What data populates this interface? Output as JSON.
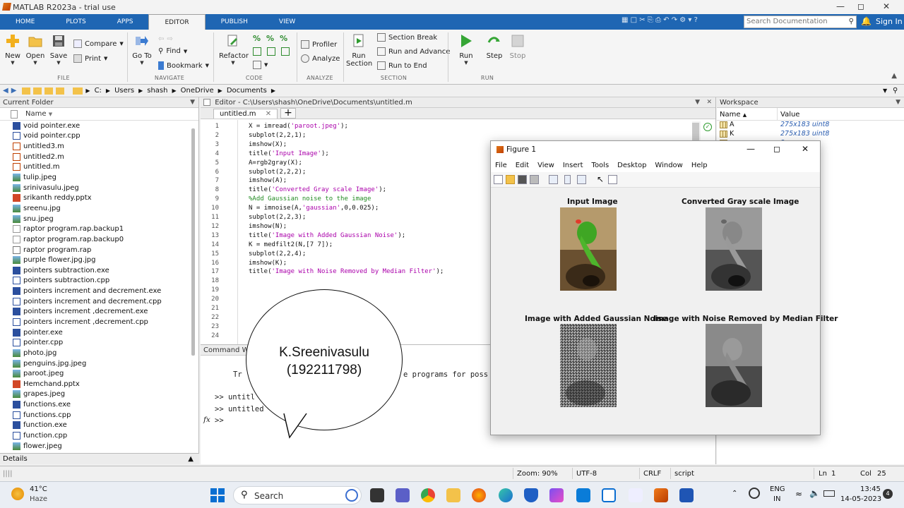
{
  "window": {
    "title": "MATLAB R2023a - trial use"
  },
  "tabs": [
    "HOME",
    "PLOTS",
    "APPS",
    "EDITOR",
    "PUBLISH",
    "VIEW"
  ],
  "search_doc": {
    "placeholder": "Search Documentation"
  },
  "sign_in": "Sign In",
  "ribbon": {
    "new": "New",
    "open": "Open",
    "save": "Save",
    "compare": "Compare",
    "print": "Print",
    "file_group": "FILE",
    "goto": "Go To",
    "find": "Find",
    "bookmark": "Bookmark",
    "navigate_group": "NAVIGATE",
    "refactor": "Refactor",
    "code_group": "CODE",
    "profiler": "Profiler",
    "analyze": "Analyze",
    "analyze_group": "ANALYZE",
    "run_section_1": "Run",
    "run_section_2": "Section",
    "section_break": "Section Break",
    "run_and_advance": "Run and Advance",
    "run_to_end": "Run to End",
    "section_group": "SECTION",
    "run": "Run",
    "step": "Step",
    "stop": "Stop",
    "run_group": "RUN"
  },
  "address": [
    "C:",
    "Users",
    "shash",
    "OneDrive",
    "Documents"
  ],
  "current_folder": {
    "title": "Current Folder",
    "col_name": "Name",
    "files": [
      {
        "name": "void pointer.exe",
        "type": "exe"
      },
      {
        "name": "void pointer.cpp",
        "type": "cpp"
      },
      {
        "name": "untitled3.m",
        "type": "m"
      },
      {
        "name": "untitled2.m",
        "type": "m"
      },
      {
        "name": "untitled.m",
        "type": "m"
      },
      {
        "name": "tulip.jpeg",
        "type": "img"
      },
      {
        "name": "srinivasulu.jpeg",
        "type": "img"
      },
      {
        "name": "srikanth reddy.pptx",
        "type": "ppt"
      },
      {
        "name": "sreenu.jpg",
        "type": "img"
      },
      {
        "name": "snu.jpeg",
        "type": "img"
      },
      {
        "name": "raptor program.rap.backup1",
        "type": "file"
      },
      {
        "name": "raptor program.rap.backup0",
        "type": "file"
      },
      {
        "name": "raptor program.rap",
        "type": "rap"
      },
      {
        "name": "purple flower.jpg.jpg",
        "type": "img"
      },
      {
        "name": "pointers subtraction.exe",
        "type": "exe"
      },
      {
        "name": "pointers subtraction.cpp",
        "type": "cpp"
      },
      {
        "name": "pointers increment and decrement.exe",
        "type": "exe"
      },
      {
        "name": "pointers increment and decrement.cpp",
        "type": "cpp"
      },
      {
        "name": "pointers increment ,decrement.exe",
        "type": "exe"
      },
      {
        "name": "pointers increment ,decrement.cpp",
        "type": "cpp"
      },
      {
        "name": "pointer.exe",
        "type": "exe"
      },
      {
        "name": "pointer.cpp",
        "type": "cpp"
      },
      {
        "name": "photo.jpg",
        "type": "img"
      },
      {
        "name": "penguins.jpg.jpeg",
        "type": "img"
      },
      {
        "name": "paroot.jpeg",
        "type": "img"
      },
      {
        "name": "Hemchand.pptx",
        "type": "ppt"
      },
      {
        "name": "grapes.jpeg",
        "type": "img"
      },
      {
        "name": "functions.exe",
        "type": "exe"
      },
      {
        "name": "functions.cpp",
        "type": "cpp"
      },
      {
        "name": "function.exe",
        "type": "exe"
      },
      {
        "name": "function.cpp",
        "type": "cpp"
      },
      {
        "name": "flower.jpeg",
        "type": "img"
      }
    ],
    "details": "Details"
  },
  "editor": {
    "header": "Editor - C:\\Users\\shash\\OneDrive\\Documents\\untitled.m",
    "tab": "untitled.m",
    "plus": "+",
    "lines": [
      "X = imread('paroot.jpeg');",
      "subplot(2,2,1);",
      "imshow(X);",
      "title('Input Image');",
      "A=rgb2gray(X);",
      "subplot(2,2,2);",
      "imshow(A);",
      "title('Converted Gray scale Image');",
      "%Add Gaussian noise to the image",
      "N = imnoise(A,'gaussian',0,0.025);",
      "subplot(2,2,3);",
      "imshow(N);",
      "title('Image with Added Gaussian Noise');",
      "K = medfilt2(N,[7 7]);",
      "subplot(2,2,4);",
      "imshow(K);",
      "title('Image with Noise Removed by Median Filter');",
      "",
      "",
      "",
      "",
      "",
      "",
      ""
    ]
  },
  "command_window": {
    "title": "Command Wi",
    "line1a": "Tr",
    "line1b": "e programs for poss",
    "prompt1": ">> untitl",
    "prompt2": ">> untitled",
    "prompt3": ">>",
    "fx": "fx"
  },
  "workspace": {
    "title": "Workspace",
    "col_name": "Name",
    "col_value": "Value",
    "rows": [
      {
        "name": "A",
        "value": "275x183 uint8"
      },
      {
        "name": "K",
        "value": "275x183 uint8"
      },
      {
        "name": "",
        "value": "8"
      },
      {
        "name": "",
        "value": "int8"
      }
    ]
  },
  "figure": {
    "title": "Figure 1",
    "menu": [
      "File",
      "Edit",
      "View",
      "Insert",
      "Tools",
      "Desktop",
      "Window",
      "Help"
    ],
    "subplots": [
      "Input Image",
      "Converted Gray scale Image",
      "Image with Added Gaussian Noise",
      "Image with Noise Removed by Median Filter"
    ]
  },
  "bubble": {
    "line1": "K.Sreenivasulu",
    "line2": "(192211798)"
  },
  "status": {
    "zoom": "Zoom: 90%",
    "encoding": "UTF-8",
    "eol": "CRLF",
    "type": "script",
    "ln_label": "Ln",
    "ln": "1",
    "col_label": "Col",
    "col": "25"
  },
  "taskbar": {
    "weather_temp": "41°C",
    "weather_desc": "Haze",
    "search": "Search",
    "lang1": "ENG",
    "lang2": "IN",
    "time": "13:45",
    "date": "14-05-2023",
    "notif": "4"
  }
}
